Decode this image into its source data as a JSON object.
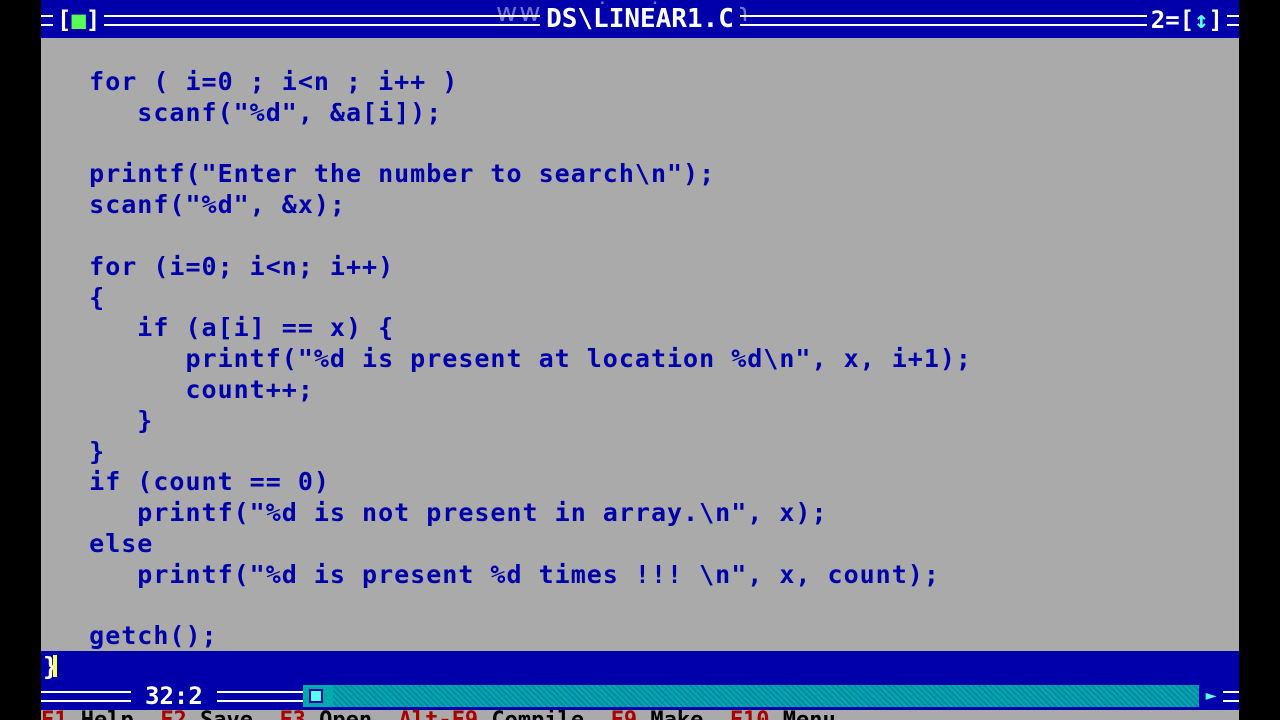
{
  "window": {
    "title": "DS\\LINEAR1.C",
    "close_glyph": "■",
    "window_number": "2",
    "zoom_glyph": "↕",
    "watermark": "www.zdcode.com"
  },
  "editor": {
    "lines": [
      "   for ( i=0 ; i<n ; i++ )",
      "      scanf(\"%d\", &a[i]);",
      "",
      "   printf(\"Enter the number to search\\n\");",
      "   scanf(\"%d\", &x);",
      "",
      "   for (i=0; i<n; i++)",
      "   {",
      "      if (a[i] == x) {",
      "         printf(\"%d is present at location %d\\n\", x, i+1);",
      "         count++;",
      "      }",
      "   }",
      "   if (count == 0)",
      "      printf(\"%d is not present in array.\\n\", x);",
      "   else",
      "      printf(\"%d is present %d times !!! \\n\", x, count);",
      "",
      "   getch();"
    ],
    "cursor_line_text": "}"
  },
  "status": {
    "position": "32:2"
  },
  "menu": {
    "items": [
      {
        "key": "F1",
        "label": "Help"
      },
      {
        "key": "F2",
        "label": "Save"
      },
      {
        "key": "F3",
        "label": "Open"
      },
      {
        "key": "Alt-F9",
        "label": "Compile"
      },
      {
        "key": "F9",
        "label": "Make"
      },
      {
        "key": "F10",
        "label": "Menu"
      }
    ]
  },
  "colors": {
    "background": "#aaaaaa",
    "bar": "#0000aa",
    "text": "#0000aa",
    "highlight_text": "#ffffff",
    "accent_cyan": "#00aaaa",
    "hotkey": "#aa0000"
  }
}
